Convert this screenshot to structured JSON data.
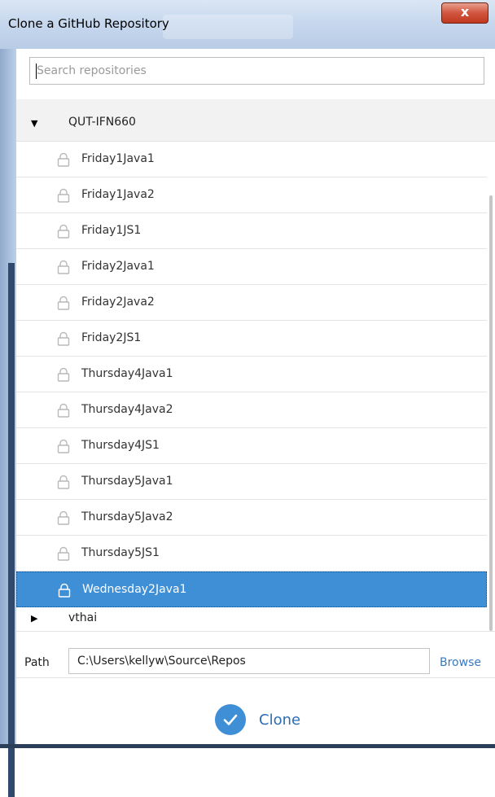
{
  "window": {
    "title": "Clone a GitHub Repository",
    "close_glyph": "x"
  },
  "search": {
    "placeholder": "Search repositories",
    "value": ""
  },
  "groups": [
    {
      "label": "QUT-IFN660",
      "expanded": true
    },
    {
      "label": "vthai",
      "expanded": false
    }
  ],
  "repos": [
    {
      "name": "Friday1Java1",
      "icon": "lock-icon"
    },
    {
      "name": "Friday1Java2",
      "icon": "lock-icon"
    },
    {
      "name": "Friday1JS1",
      "icon": "lock-icon"
    },
    {
      "name": "Friday2Java1",
      "icon": "lock-icon"
    },
    {
      "name": "Friday2Java2",
      "icon": "lock-icon"
    },
    {
      "name": "Friday2JS1",
      "icon": "lock-icon"
    },
    {
      "name": "Thursday4Java1",
      "icon": "lock-icon"
    },
    {
      "name": "Thursday4Java2",
      "icon": "lock-icon"
    },
    {
      "name": "Thursday4JS1",
      "icon": "lock-icon"
    },
    {
      "name": "Thursday5Java1",
      "icon": "lock-icon"
    },
    {
      "name": "Thursday5Java2",
      "icon": "lock-icon"
    },
    {
      "name": "Thursday5JS1",
      "icon": "lock-icon"
    },
    {
      "name": "Wednesday2Java1",
      "icon": "lock-icon",
      "selected": true
    }
  ],
  "path": {
    "label": "Path",
    "value": "C:\\Users\\kellyw\\Source\\Repos",
    "browse_label": "Browse"
  },
  "clone": {
    "label": "Clone"
  },
  "colors": {
    "accent": "#3f8fd6",
    "link": "#3879c4",
    "close": "#c0371f"
  }
}
